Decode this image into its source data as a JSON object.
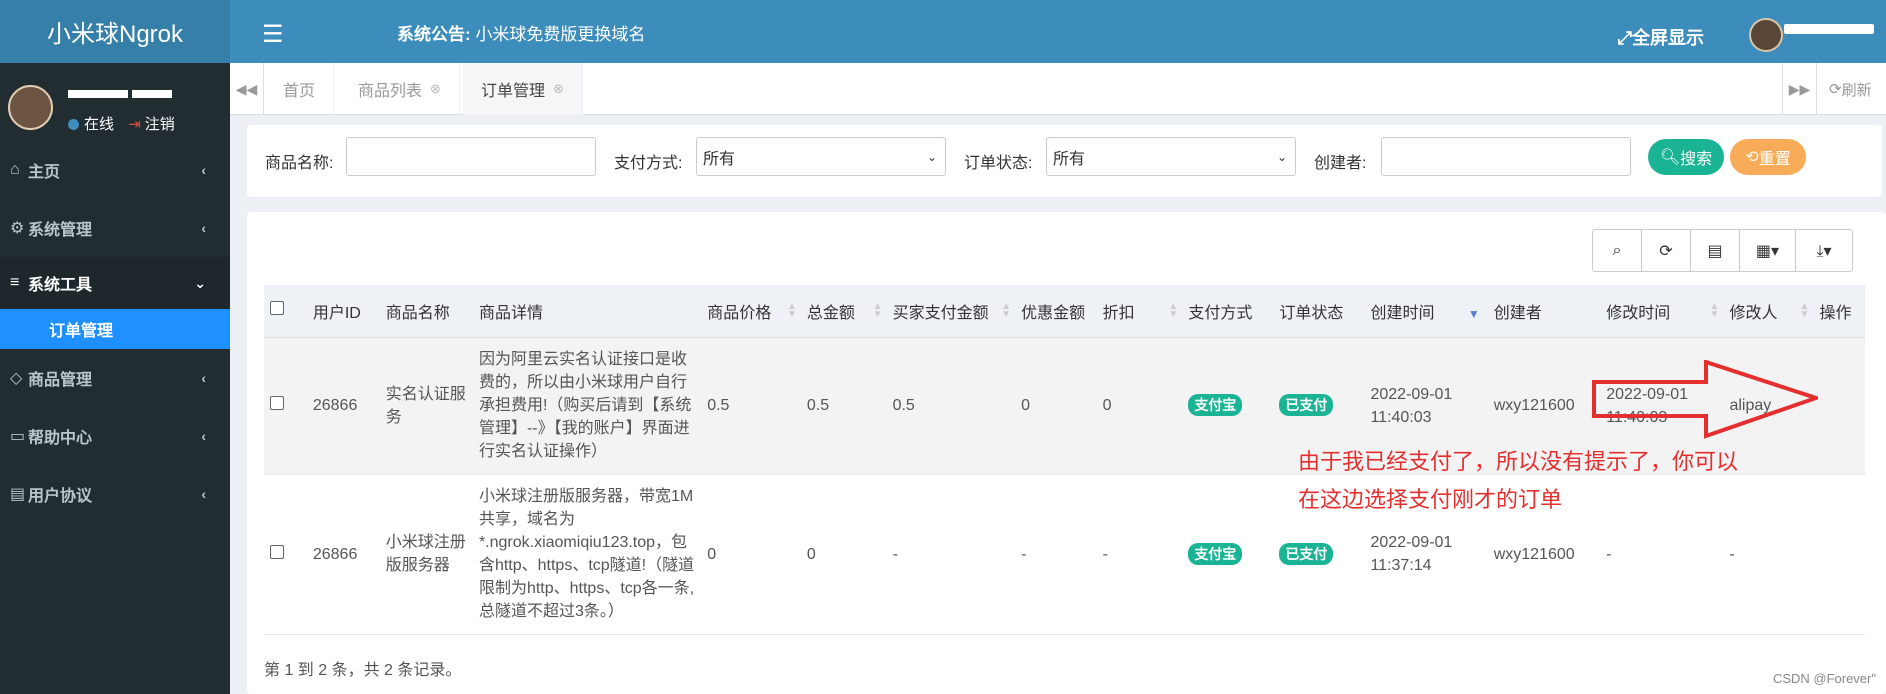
{
  "app": {
    "title": "小米球Ngrok"
  },
  "header": {
    "notice_label": "系统公告:",
    "notice_text": "小米球免费版更换域名",
    "fullscreen_label": "全屏显示"
  },
  "sidebar": {
    "user_status": "在线",
    "logout_label": "注销",
    "items": [
      {
        "label": "主页",
        "icon": "home-icon"
      },
      {
        "label": "系统管理",
        "icon": "gear-icon"
      },
      {
        "label": "系统工具",
        "icon": "bars-icon"
      },
      {
        "label": "商品管理",
        "icon": "diamond-icon"
      },
      {
        "label": "帮助中心",
        "icon": "monitor-icon"
      },
      {
        "label": "用户协议",
        "icon": "id-card-icon"
      }
    ],
    "active_submenu": "订单管理"
  },
  "tabs": {
    "items": [
      {
        "label": "首页"
      },
      {
        "label": "商品列表"
      },
      {
        "label": "订单管理"
      }
    ],
    "refresh_label": "刷新"
  },
  "search": {
    "product_name_label": "商品名称:",
    "product_name_value": "",
    "pay_method_label": "支付方式:",
    "pay_method_value": "所有",
    "order_status_label": "订单状态:",
    "order_status_value": "所有",
    "creator_label": "创建者:",
    "creator_value": "",
    "search_button": "搜索",
    "reset_button": "重置"
  },
  "table": {
    "columns": [
      "用户ID",
      "商品名称",
      "商品详情",
      "商品价格",
      "总金额",
      "买家支付金额",
      "优惠金额",
      "折扣",
      "支付方式",
      "订单状态",
      "创建时间",
      "创建者",
      "修改时间",
      "修改人",
      "操作"
    ],
    "rows": [
      {
        "user_id": "26866",
        "product_name": "实名认证服务",
        "detail": "因为阿里云实名认证接口是收费的，所以由小米球用户自行承担费用!（购买后请到【系统管理】--》【我的账户】界面进行实名认证操作）",
        "price": "0.5",
        "total": "0.5",
        "buyer_paid": "0.5",
        "discount_amount": "0",
        "discount": "0",
        "pay_method": "支付宝",
        "status": "已支付",
        "created_time": "2022-09-01 11:40:03",
        "creator": "wxy121600",
        "modified_time": "2022-09-01 11:40:03",
        "modifier": "alipay",
        "action": ""
      },
      {
        "user_id": "26866",
        "product_name": "小米球注册版服务器",
        "detail": "小米球注册版服务器，带宽1M共享，域名为*.ngrok.xiaomiqiu123.top，包含http、https、tcp隧道!（隧道限制为http、https、tcp各一条,总隧道不超过3条。）",
        "price": "0",
        "total": "0",
        "buyer_paid": "-",
        "discount_amount": "-",
        "discount": "-",
        "pay_method": "支付宝",
        "status": "已支付",
        "created_time": "2022-09-01 11:37:14",
        "creator": "wxy121600",
        "modified_time": "-",
        "modifier": "-",
        "action": ""
      }
    ],
    "footer": "第 1 到 2 条，共 2 条记录。"
  },
  "annotation": {
    "text": "由于我已经支付了，所以没有提示了，你可以在这边选择支付刚才的订单",
    "color": "#e52f2f"
  },
  "watermark": "CSDN @Forever\"",
  "colors": {
    "brand_dark": "#367fa9",
    "brand": "#3c8dbc",
    "sidebar": "#222d32",
    "active_submenu": "#1e90ff",
    "success": "#1ab394",
    "warning": "#f8ac59"
  }
}
